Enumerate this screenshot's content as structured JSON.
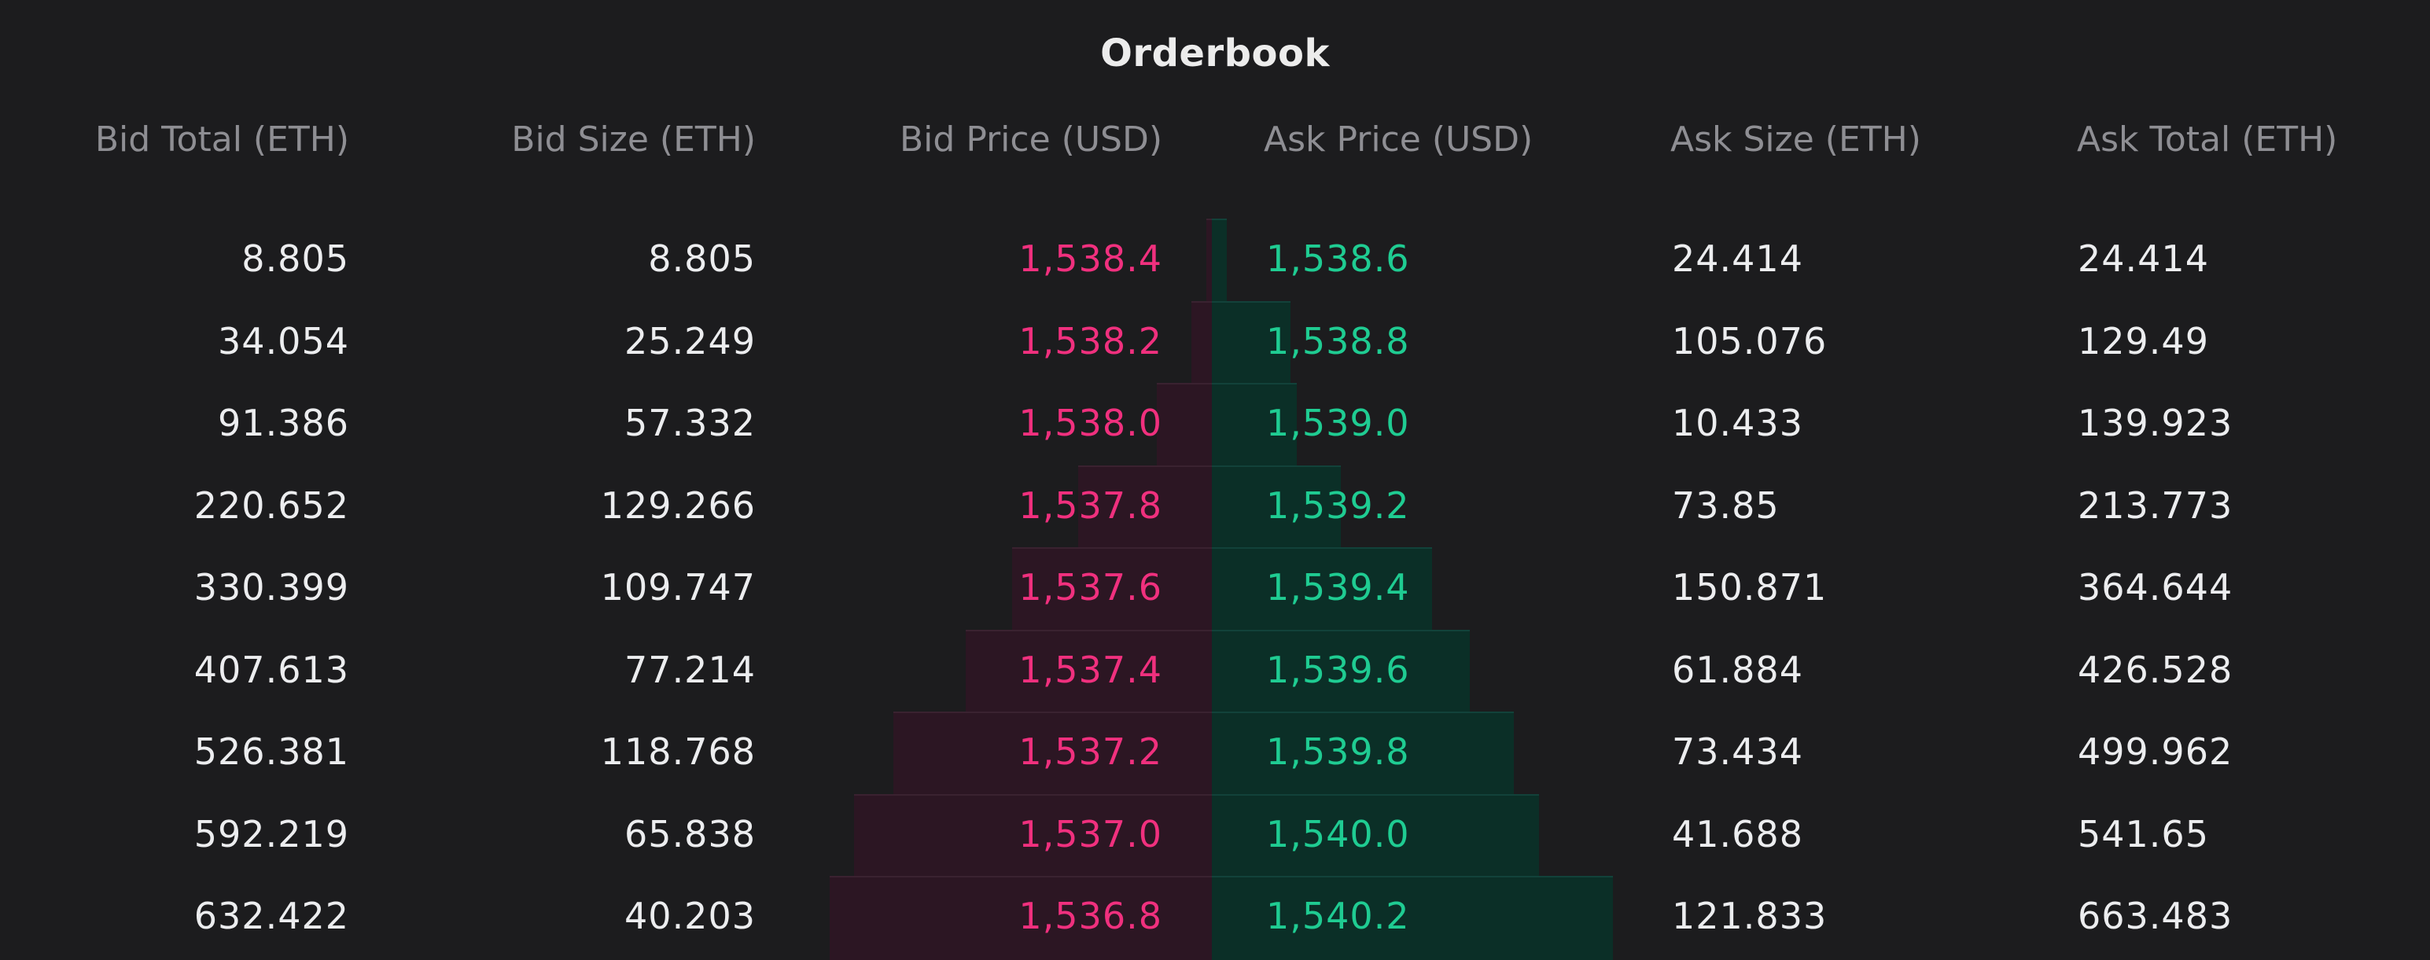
{
  "title": "Orderbook",
  "headers": {
    "bid_total": "Bid Total (ETH)",
    "bid_size": "Bid Size (ETH)",
    "bid_price": "Bid Price (USD)",
    "ask_price": "Ask Price (USD)",
    "ask_size": "Ask Size (ETH)",
    "ask_total": "Ask Total (ETH)"
  },
  "colors": {
    "bid_price": "#f0307e",
    "ask_price": "#1fcc92",
    "bid_depth": "#2c1623",
    "ask_depth": "#0b2f27",
    "background": "#1c1c1e"
  },
  "rows": [
    {
      "bid_total": "8.805",
      "bid_size": "8.805",
      "bid_price": "1,538.4",
      "ask_price": "1,538.6",
      "ask_size": "24.414",
      "ask_total": "24.414"
    },
    {
      "bid_total": "34.054",
      "bid_size": "25.249",
      "bid_price": "1,538.2",
      "ask_price": "1,538.8",
      "ask_size": "105.076",
      "ask_total": "129.49"
    },
    {
      "bid_total": "91.386",
      "bid_size": "57.332",
      "bid_price": "1,538.0",
      "ask_price": "1,539.0",
      "ask_size": "10.433",
      "ask_total": "139.923"
    },
    {
      "bid_total": "220.652",
      "bid_size": "129.266",
      "bid_price": "1,537.8",
      "ask_price": "1,539.2",
      "ask_size": "73.85",
      "ask_total": "213.773"
    },
    {
      "bid_total": "330.399",
      "bid_size": "109.747",
      "bid_price": "1,537.6",
      "ask_price": "1,539.4",
      "ask_size": "150.871",
      "ask_total": "364.644"
    },
    {
      "bid_total": "407.613",
      "bid_size": "77.214",
      "bid_price": "1,537.4",
      "ask_price": "1,539.6",
      "ask_size": "61.884",
      "ask_total": "426.528"
    },
    {
      "bid_total": "526.381",
      "bid_size": "118.768",
      "bid_price": "1,537.2",
      "ask_price": "1,539.8",
      "ask_size": "73.434",
      "ask_total": "499.962"
    },
    {
      "bid_total": "592.219",
      "bid_size": "65.838",
      "bid_price": "1,537.0",
      "ask_price": "1,540.0",
      "ask_size": "41.688",
      "ask_total": "541.65"
    },
    {
      "bid_total": "632.422",
      "bid_size": "40.203",
      "bid_price": "1,536.8",
      "ask_price": "1,540.2",
      "ask_size": "121.833",
      "ask_total": "663.483"
    }
  ]
}
